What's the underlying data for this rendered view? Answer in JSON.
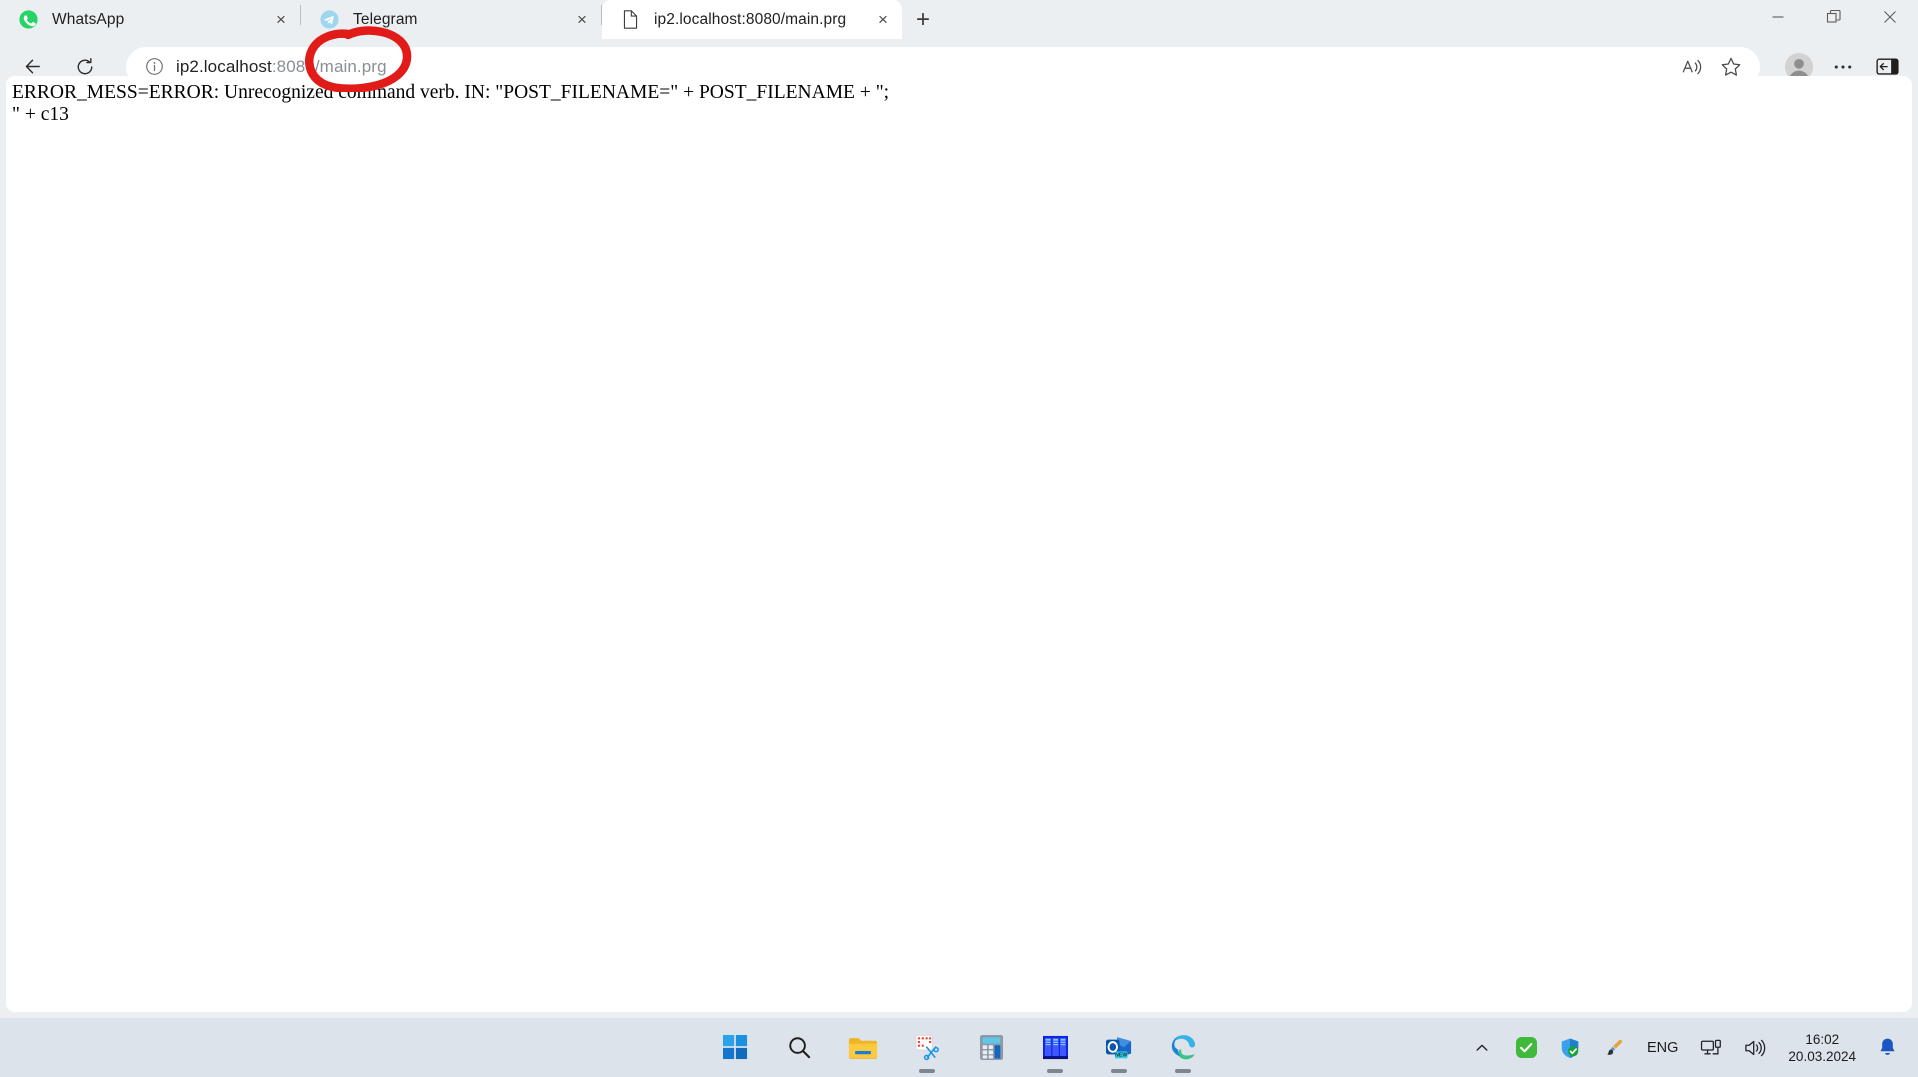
{
  "browser": {
    "tabs": [
      {
        "title": "WhatsApp",
        "icon": "whatsapp-icon",
        "active": false,
        "close_label": "×"
      },
      {
        "title": "Telegram",
        "icon": "telegram-icon",
        "active": false,
        "close_label": "×"
      },
      {
        "title": "ip2.localhost:8080/main.prg",
        "icon": "page-document-icon",
        "active": true,
        "close_label": "×"
      }
    ],
    "new_tab_label": "+",
    "window_controls": {
      "minimize": "—",
      "restore": "❐",
      "close": "✕"
    },
    "toolbar": {
      "back_label": "←",
      "refresh_label": "⟳",
      "site_info_label": "ⓘ",
      "url_host": "ip2.localhost",
      "url_rest": ":8080/main.prg",
      "url_full": "ip2.localhost:8080/main.prg",
      "read_aloud_label": "A",
      "favorite_label": "☆",
      "profile_label": "profile",
      "settings_label": "…",
      "split_screen_label": "⬒"
    }
  },
  "page": {
    "line1": "ERROR_MESS=ERROR: Unrecognized command verb. IN: \"POST_FILENAME=\" + POST_FILENAME + \";",
    "line2": "\" + c13",
    "body_text": "ERROR_MESS=ERROR: Unrecognized command verb. IN: \"POST_FILENAME=\" + POST_FILENAME + \";\n\" + c13"
  },
  "annotation": {
    "type": "hand-drawn-red-ellipse",
    "color": "#e01b18",
    "target_text": "/main.prg"
  },
  "taskbar": {
    "apps": [
      {
        "name": "start-button",
        "label": "Start",
        "running": false
      },
      {
        "name": "search-button",
        "label": "Search",
        "running": false
      },
      {
        "name": "file-explorer",
        "label": "File Explorer",
        "running": false
      },
      {
        "name": "snipping-tool",
        "label": "Snipping Tool",
        "running": true
      },
      {
        "name": "calculator",
        "label": "Calculator",
        "running": false
      },
      {
        "name": "database-app",
        "label": "Application",
        "running": true
      },
      {
        "name": "outlook-new",
        "label": "Outlook (new)",
        "running": true,
        "badge": "NEW"
      },
      {
        "name": "microsoft-edge",
        "label": "Microsoft Edge",
        "running": true
      }
    ],
    "tray": {
      "overflow_label": "˄",
      "items": [
        {
          "name": "green-check-icon",
          "label": "OK"
        },
        {
          "name": "windows-security-icon",
          "label": "Windows Security"
        },
        {
          "name": "paint-brush-icon",
          "label": "Paint"
        }
      ],
      "language": "ENG",
      "network_label": "Network",
      "volume_label": "Volume",
      "time": "16:02",
      "date": "20.03.2024",
      "notifications_label": "Notifications"
    }
  },
  "colors": {
    "accent_blue": "#0f6cbd",
    "annotation_red": "#e01b18",
    "taskbar_bg": "#dde3ea",
    "browser_chrome": "#eceff1",
    "active_tab": "#ffffff"
  }
}
